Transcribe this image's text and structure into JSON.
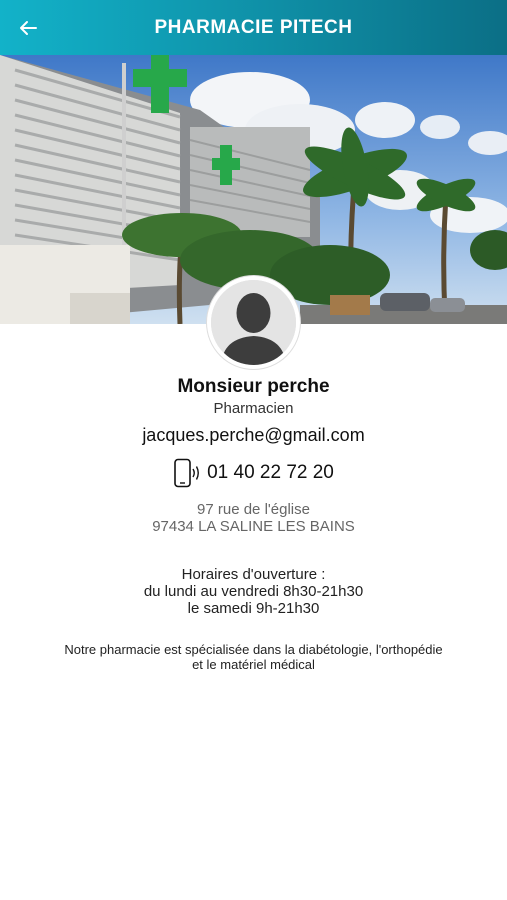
{
  "header": {
    "title": "PHARMACIE PITECH",
    "back_icon": "arrow-left-icon",
    "gradient": [
      "#12b2c9",
      "#0b6f86"
    ]
  },
  "hero": {
    "image": "pharmacy-building-photo"
  },
  "profile": {
    "avatar_icon": "person-silhouette-icon",
    "name": "Monsieur perche",
    "role": "Pharmacien",
    "email": "jacques.perche@gmail.com",
    "phone_icon": "mobile-phone-icon",
    "phone": "01 40 22 72 20"
  },
  "address": {
    "line1": "97 rue de l'église",
    "line2": "97434 LA SALINE LES BAINS"
  },
  "hours": {
    "title": "Horaires d'ouverture :",
    "line1": "du lundi au vendredi 8h30-21h30",
    "line2": "le samedi 9h-21h30"
  },
  "description": {
    "line1": "Notre pharmacie est spécialisée dans la diabétologie, l'orthopédie",
    "line2": "et le matériel médical"
  },
  "colors": {
    "cross_green": "#27a84a",
    "address_gray": "#666666"
  }
}
